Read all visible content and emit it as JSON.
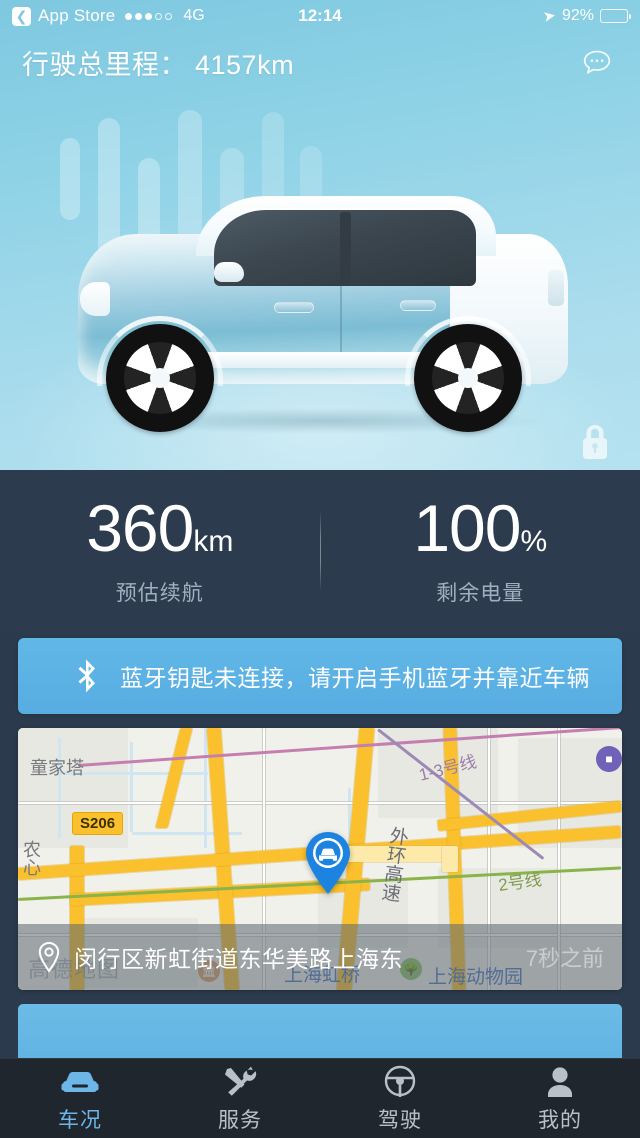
{
  "status_bar": {
    "back_icon": "chevron-left-icon",
    "carrier": "App Store",
    "signal_dots_filled": 3,
    "signal_dots_total": 5,
    "network": "4G",
    "time": "12:14",
    "location_icon": "location-arrow-icon",
    "battery_percent": "92%",
    "battery_level": 92,
    "battery_color": "#f5c518"
  },
  "hero": {
    "mileage_label": "行驶总里程：",
    "mileage_value": "4157km",
    "mileage_full": "行驶总里程： 4157km",
    "chat_icon": "chat-bubble-icon",
    "lock_icon": "lock-icon",
    "background_color": "#8ed2e6"
  },
  "stats": [
    {
      "value": "360",
      "unit": "km",
      "label": "预估续航"
    },
    {
      "value": "100",
      "unit": "%",
      "label": "剩余电量"
    }
  ],
  "bluetooth_banner": {
    "icon": "bluetooth-icon",
    "text": "蓝牙钥匙未连接，请开启手机蓝牙并靠近车辆",
    "color": "#5bb2e4"
  },
  "map": {
    "vehicle_marker_icon": "car-pin-marker",
    "pin_icon": "location-pin-icon",
    "address": "闵行区新虹街道东华美路上海东",
    "time_ago": "7秒之前",
    "watermark": "高德地图",
    "highway_shield": "S206",
    "labels": [
      {
        "text": "童家塔"
      },
      {
        "text": "1-3号线"
      },
      {
        "text": "外环高速"
      },
      {
        "text": "2号线"
      },
      {
        "text": "上海虹桥"
      },
      {
        "text": "上海动物园"
      },
      {
        "text": "农心"
      }
    ],
    "road_color": "#fbc02d",
    "metro_line_1_3_color": "#c47fb0",
    "metro_line_2_color": "#8ab34a"
  },
  "tabs": [
    {
      "label": "车况",
      "icon": "car-icon",
      "active": true
    },
    {
      "label": "服务",
      "icon": "tools-icon",
      "active": false
    },
    {
      "label": "驾驶",
      "icon": "steering-wheel-icon",
      "active": false
    },
    {
      "label": "我的",
      "icon": "person-icon",
      "active": false
    }
  ]
}
